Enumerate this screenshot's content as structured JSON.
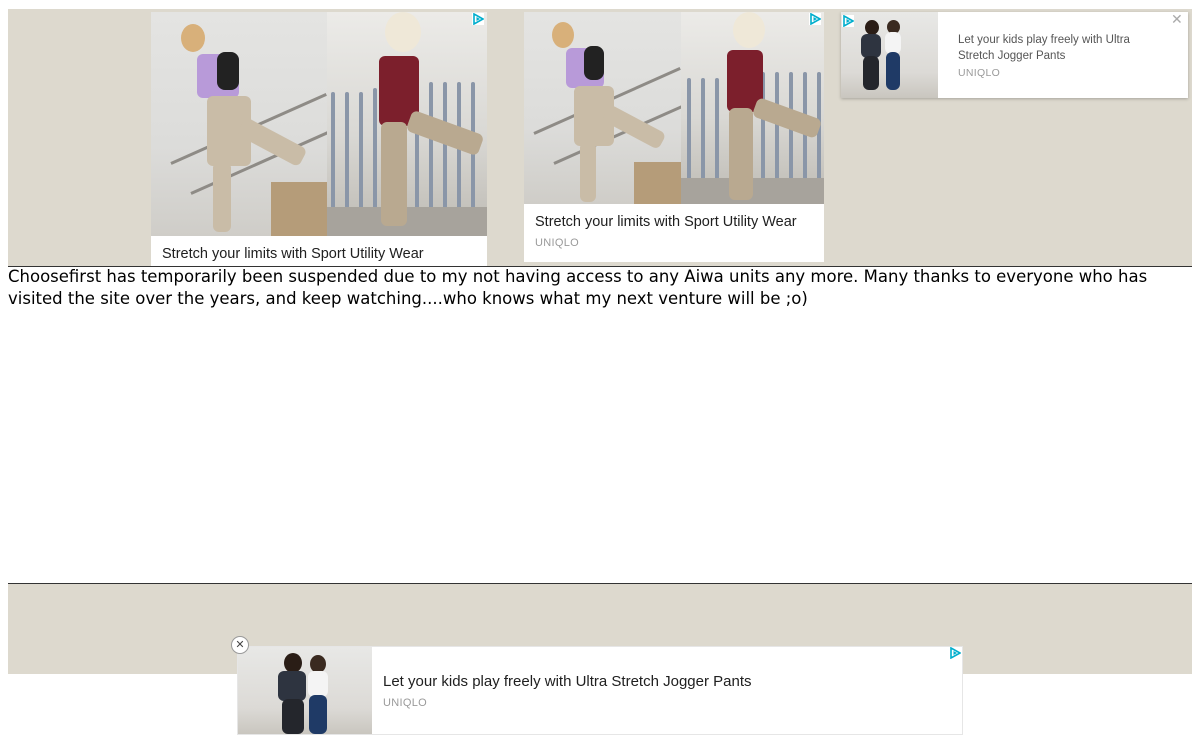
{
  "ads": {
    "top_left": {
      "caption": "Stretch your limits with Sport Utility Wear"
    },
    "top_middle": {
      "caption": "Stretch your limits with Sport Utility Wear",
      "brand": "UNIQLO"
    },
    "top_right": {
      "caption": "Let your kids play freely with Ultra Stretch Jogger Pants",
      "brand": "UNIQLO",
      "close_glyph": "✕"
    },
    "anchor": {
      "caption": "Let your kids play freely with Ultra Stretch Jogger Pants",
      "brand": "UNIQLO",
      "close_glyph": "✕"
    },
    "adchoices_icon": "adchoices-triangle",
    "band_color": "#ddd9ce",
    "adchoices_color": "#00aecd"
  },
  "notice": {
    "text": "Choosefirst has temporarily been suspended due to my not having access to any Aiwa units any more. Many thanks to everyone who has visited the site over the years, and keep watching....who knows what my next venture will be ;o)"
  }
}
